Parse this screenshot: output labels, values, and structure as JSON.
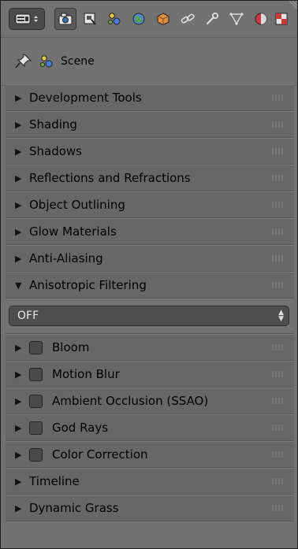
{
  "context": {
    "label": "Scene"
  },
  "panels": [
    {
      "title": "Development Tools"
    },
    {
      "title": "Shading"
    },
    {
      "title": "Shadows"
    },
    {
      "title": "Reflections and Refractions"
    },
    {
      "title": "Object Outlining"
    },
    {
      "title": "Glow Materials"
    },
    {
      "title": "Anti-Aliasing"
    },
    {
      "title": "Anisotropic Filtering",
      "expanded": true
    },
    {
      "title": "Bloom",
      "checkbox": false
    },
    {
      "title": "Motion Blur",
      "checkbox": false
    },
    {
      "title": "Ambient Occlusion (SSAO)",
      "checkbox": false
    },
    {
      "title": "God Rays",
      "checkbox": false
    },
    {
      "title": "Color Correction",
      "checkbox": false
    },
    {
      "title": "Timeline"
    },
    {
      "title": "Dynamic Grass"
    }
  ],
  "anisotropic": {
    "value": "OFF"
  },
  "colors": {
    "background": "#727272",
    "panel": "#676767",
    "dropdown": "#4e4e4e"
  },
  "toolbar": {
    "tabs": [
      "render-icon",
      "render-layers-icon",
      "scene-icon",
      "world-icon",
      "object-icon",
      "constraints-icon",
      "modifiers-icon",
      "data-icon",
      "material-icon",
      "texture-icon"
    ]
  }
}
